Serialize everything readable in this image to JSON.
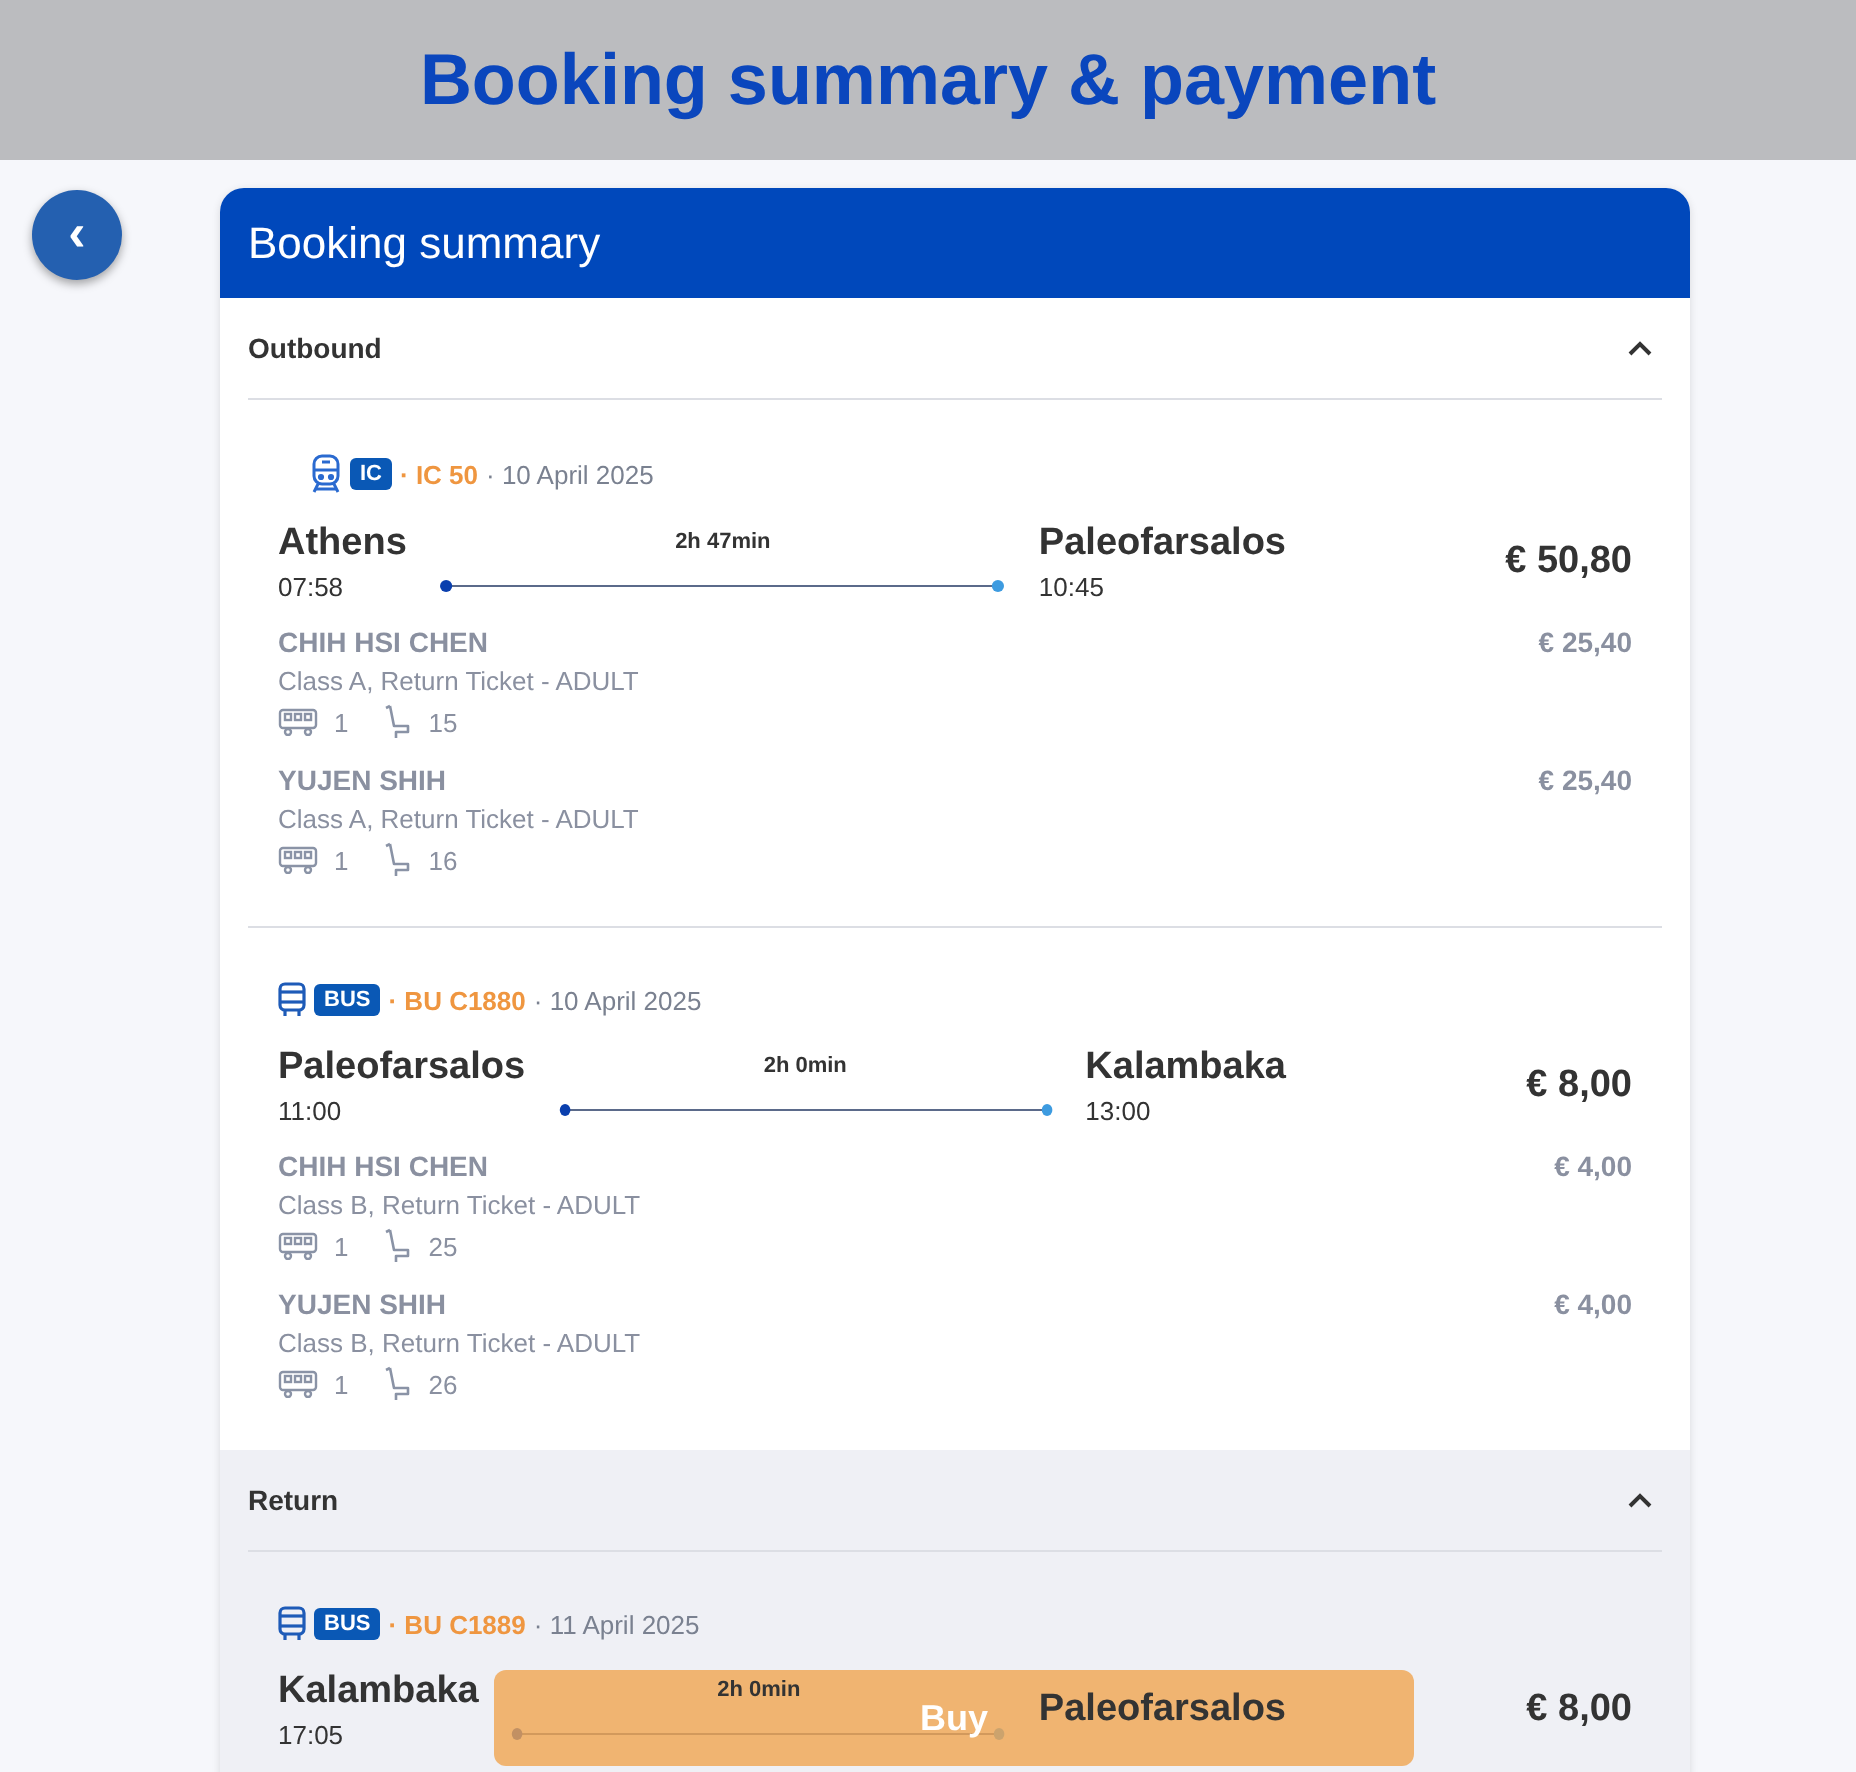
{
  "page_title": "Booking summary & payment",
  "back_button": {
    "label": "‹"
  },
  "card": {
    "title": "Booking summary",
    "sections": [
      {
        "title": "Outbound",
        "expanded": true,
        "segments": [
          {
            "kind": "train",
            "badge": "IC",
            "service": "· IC 50",
            "date": "· 10 April 2025",
            "from": "Athens",
            "departure": "07:58",
            "duration": "2h 47min",
            "to": "Paleofarsalos",
            "arrival": "10:45",
            "price": "€ 50,80",
            "passengers": [
              {
                "name": "CHIH HSI CHEN",
                "ticket": "Class A, Return Ticket - ADULT",
                "coach": "1",
                "seat": "15",
                "price": "€ 25,40"
              },
              {
                "name": "YUJEN SHIH",
                "ticket": "Class A, Return Ticket - ADULT",
                "coach": "1",
                "seat": "16",
                "price": "€ 25,40"
              }
            ]
          },
          {
            "kind": "bus",
            "badge": "BUS",
            "service": "· BU C1880",
            "date": "· 10 April 2025",
            "from": "Paleofarsalos",
            "departure": "11:00",
            "duration": "2h 0min",
            "to": "Kalambaka",
            "arrival": "13:00",
            "price": "€ 8,00",
            "passengers": [
              {
                "name": "CHIH HSI CHEN",
                "ticket": "Class B, Return Ticket - ADULT",
                "coach": "1",
                "seat": "25",
                "price": "€ 4,00"
              },
              {
                "name": "YUJEN SHIH",
                "ticket": "Class B, Return Ticket - ADULT",
                "coach": "1",
                "seat": "26",
                "price": "€ 4,00"
              }
            ]
          }
        ]
      },
      {
        "title": "Return",
        "expanded": true,
        "segments": [
          {
            "kind": "bus",
            "badge": "BUS",
            "service": "· BU C1889",
            "date": "· 11 April 2025",
            "from": "Kalambaka",
            "departure": "17:05",
            "duration": "2h 0min",
            "to": "Paleofarsalos",
            "price": "€ 8,00"
          }
        ]
      }
    ]
  },
  "buy_button": {
    "label": "Buy"
  }
}
